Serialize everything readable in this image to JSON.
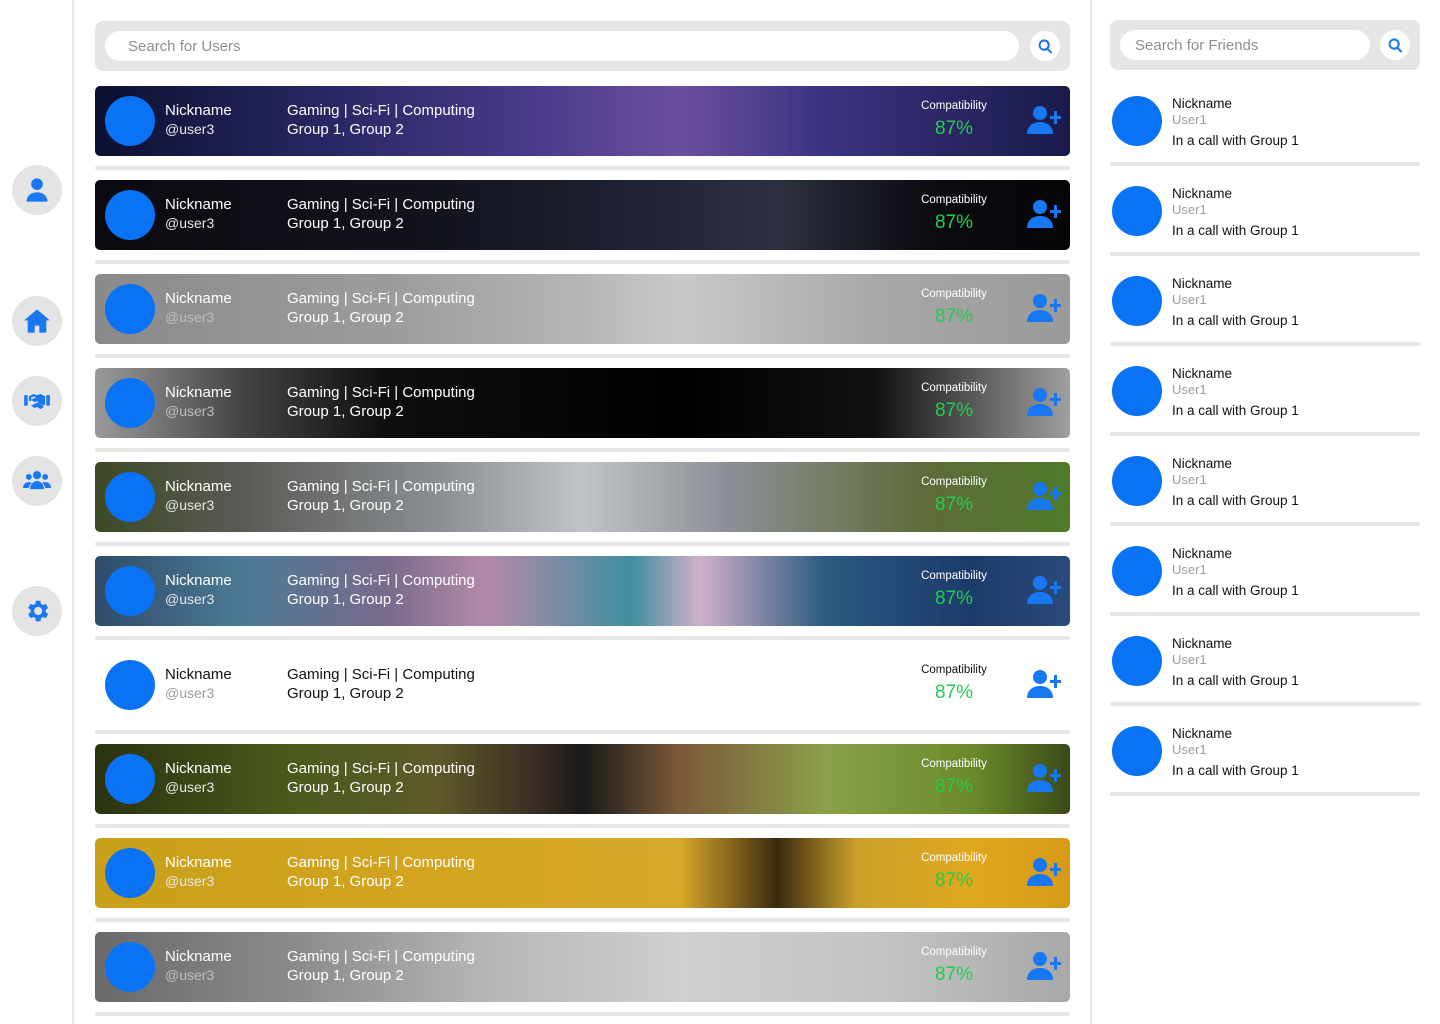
{
  "nav": {
    "items": [
      {
        "name": "profile",
        "icon": "user-icon"
      },
      {
        "name": "home",
        "icon": "home-icon"
      },
      {
        "name": "partners",
        "icon": "handshake-icon"
      },
      {
        "name": "groups",
        "icon": "users-icon"
      },
      {
        "name": "settings",
        "icon": "gear-icon"
      }
    ],
    "accent": "#1877f2"
  },
  "user_search": {
    "placeholder": "Search for Users",
    "icon": "search-icon"
  },
  "users": [
    {
      "nickname": "Nickname",
      "handle": "@user3",
      "interests": "Gaming | Sci-Fi | Computing",
      "groups": "Group 1, Group 2",
      "compat_label": "Compatibility",
      "compat": "87%",
      "banner": "galaxy"
    },
    {
      "nickname": "Nickname",
      "handle": "@user3",
      "interests": "Gaming | Sci-Fi | Computing",
      "groups": "Group 1, Group 2",
      "compat_label": "Compatibility",
      "compat": "87%",
      "banner": "code"
    },
    {
      "nickname": "Nickname",
      "handle": "@user3",
      "interests": "Gaming | Sci-Fi | Computing",
      "groups": "Group 1, Group 2",
      "compat_label": "Compatibility",
      "compat": "87%",
      "banner": "controller"
    },
    {
      "nickname": "Nickname",
      "handle": "@user3",
      "interests": "Gaming | Sci-Fi | Computing",
      "groups": "Group 1, Group 2",
      "compat_label": "Compatibility",
      "compat": "87%",
      "banner": "world-map"
    },
    {
      "nickname": "Nickname",
      "handle": "@user3",
      "interests": "Gaming | Sci-Fi | Computing",
      "groups": "Group 1, Group 2",
      "compat_label": "Compatibility",
      "compat": "87%",
      "banner": "car"
    },
    {
      "nickname": "Nickname",
      "handle": "@user3",
      "interests": "Gaming | Sci-Fi | Computing",
      "groups": "Group 1, Group 2",
      "compat_label": "Compatibility",
      "compat": "87%",
      "banner": "marble"
    },
    {
      "nickname": "Nickname",
      "handle": "@user3",
      "interests": "Gaming | Sci-Fi | Computing",
      "groups": "Group 1, Group 2",
      "compat_label": "Compatibility",
      "compat": "87%",
      "banner": "none"
    },
    {
      "nickname": "Nickname",
      "handle": "@user3",
      "interests": "Gaming | Sci-Fi | Computing",
      "groups": "Group 1, Group 2",
      "compat_label": "Compatibility",
      "compat": "87%",
      "banner": "camera"
    },
    {
      "nickname": "Nickname",
      "handle": "@user3",
      "interests": "Gaming | Sci-Fi | Computing",
      "groups": "Group 1, Group 2",
      "compat_label": "Compatibility",
      "compat": "87%",
      "banner": "sunset"
    },
    {
      "nickname": "Nickname",
      "handle": "@user3",
      "interests": "Gaming | Sci-Fi | Computing",
      "groups": "Group 1, Group 2",
      "compat_label": "Compatibility",
      "compat": "87%",
      "banner": "sheet-music"
    }
  ],
  "friend_search": {
    "placeholder": "Search for Friends",
    "icon": "search-icon"
  },
  "friends": [
    {
      "nickname": "Nickname",
      "user": "User1",
      "status": "In a call with Group 1"
    },
    {
      "nickname": "Nickname",
      "user": "User1",
      "status": "In a call with Group 1"
    },
    {
      "nickname": "Nickname",
      "user": "User1",
      "status": "In a call with Group 1"
    },
    {
      "nickname": "Nickname",
      "user": "User1",
      "status": "In a call with Group 1"
    },
    {
      "nickname": "Nickname",
      "user": "User1",
      "status": "In a call with Group 1"
    },
    {
      "nickname": "Nickname",
      "user": "User1",
      "status": "In a call with Group 1"
    },
    {
      "nickname": "Nickname",
      "user": "User1",
      "status": "In a call with Group 1"
    },
    {
      "nickname": "Nickname",
      "user": "User1",
      "status": "In a call with Group 1"
    }
  ],
  "colors": {
    "avatar": "#0a72f5",
    "compat_value": "#1fcf4d",
    "panel_gray": "#e6e6e6"
  }
}
